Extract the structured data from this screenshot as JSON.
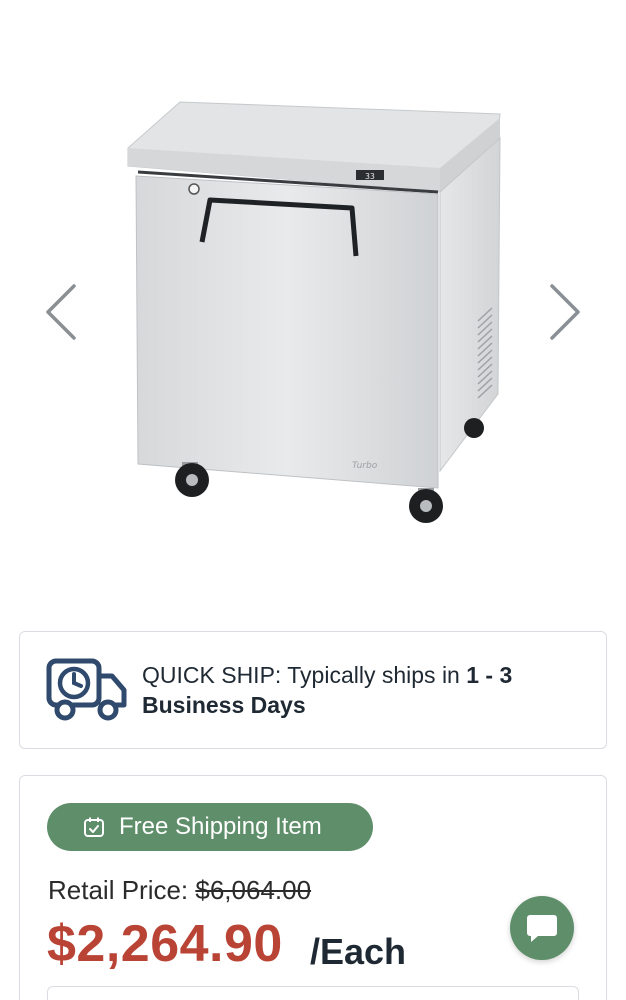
{
  "gallery": {
    "image_alt": "Undercounter refrigerator product image",
    "prev_icon": "chevron-left-icon",
    "next_icon": "chevron-right-icon",
    "display_reading": "33"
  },
  "shipping": {
    "icon": "delivery-truck-clock-icon",
    "prefix": "QUICK SHIP: Typically ships in ",
    "range": "1 - 3",
    "suffix": "Business Days"
  },
  "pricing": {
    "badge_icon": "calendar-check-icon",
    "badge_label": "Free Shipping Item",
    "retail_label": "Retail Price: ",
    "retail_value": "$6,064.00",
    "price": "$2,264.90",
    "unit": "/Each"
  },
  "chat": {
    "icon": "chat-bubble-icon"
  },
  "colors": {
    "accent_green": "#5f8f6a",
    "price_red": "#b94436",
    "truck_navy": "#2f4a6d",
    "border": "#d9dde1"
  }
}
